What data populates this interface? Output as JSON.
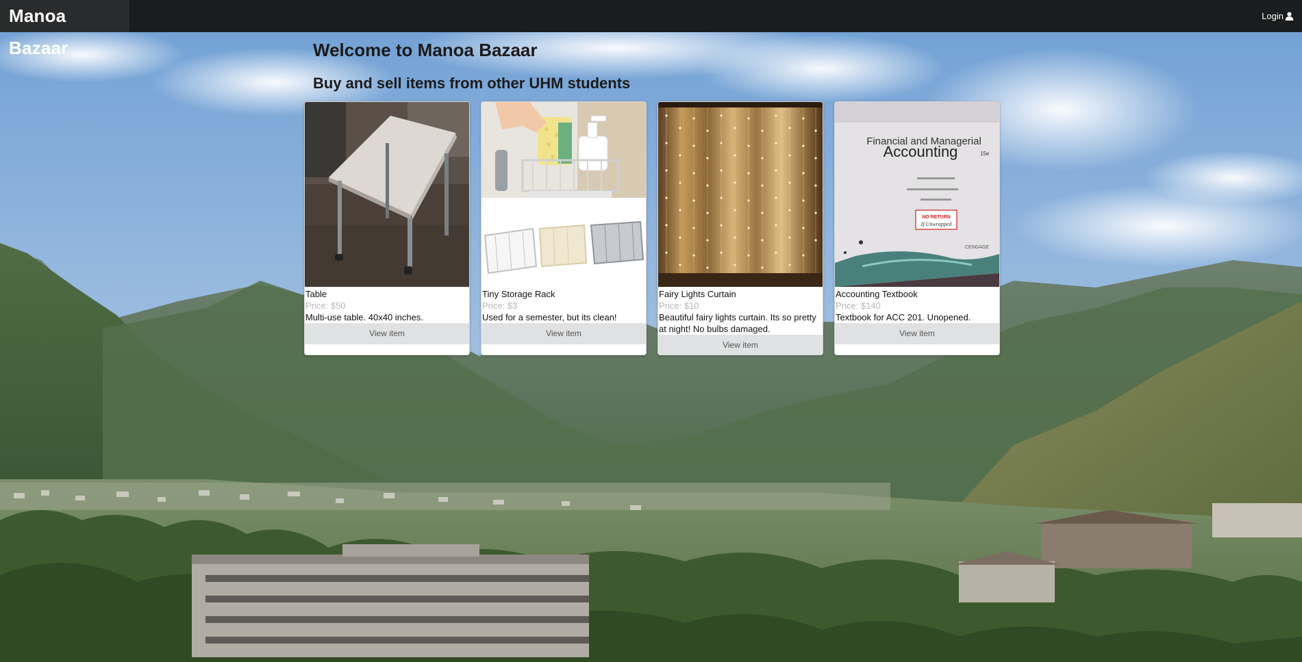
{
  "navbar": {
    "brand": "Manoa Bazaar",
    "login_label": "Login",
    "login_icon": "user-icon"
  },
  "page": {
    "title": "Welcome to Manoa Bazaar",
    "subtitle": "Buy and sell items from other UHM students"
  },
  "items": [
    {
      "title": "Table",
      "price": "Price: $50",
      "description": "Multi-use table. 40x40 inches.",
      "button": "View item",
      "image": "table-photo"
    },
    {
      "title": "Tiny Storage Rack",
      "price": "Price: $3",
      "description": "Used for a semester, but its clean!",
      "button": "View item",
      "image": "storage-rack-photo"
    },
    {
      "title": "Fairy Lights Curtain",
      "price": "Price: $10",
      "description": "Beautiful fairy lights curtain. Its so pretty at night! No bulbs damaged.",
      "button": "View item",
      "image": "fairy-lights-photo"
    },
    {
      "title": "Accounting Textbook",
      "price": "Price: $140",
      "description": "Textbook for ACC 201. Unopened.",
      "button": "View item",
      "image": "textbook-photo",
      "book_cover": {
        "line1": "Financial and Managerial",
        "line2": "Accounting",
        "edition": "15e",
        "sticker_line1": "NO RETURN",
        "sticker_line2": "If Unwrapped",
        "publisher": "CENGAGE"
      }
    }
  ],
  "colors": {
    "navbar_bg": "#1b1c1d",
    "brand_bg": "#2a2b2c",
    "button_bg": "#e0e1e2",
    "price_text": "#b5b5b5"
  }
}
